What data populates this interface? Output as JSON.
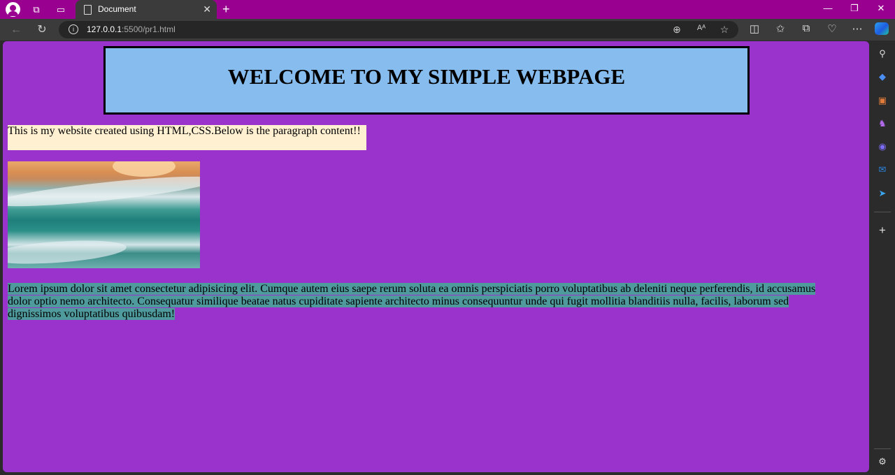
{
  "browser": {
    "tab_title": "Document",
    "tab_close_glyph": "✕",
    "new_tab_glyph": "+",
    "url_host": "127.0.0.1",
    "url_rest": ":5500/pr1.html",
    "window_controls": {
      "minimize": "—",
      "restore": "❐",
      "close": "✕"
    }
  },
  "page": {
    "heading": "WELCOME TO MY SIMPLE WEBPAGE",
    "intro_text": "This is my website created using HTML,CSS.Below is the paragraph content!!",
    "paragraph": "Lorem ipsum dolor sit amet consectetur adipisicing elit. Cumque autem eius saepe rerum soluta ea omnis perspiciatis porro voluptatibus ab deleniti neque perferendis, id accusamus dolor optio nemo architecto. Consequatur similique beatae natus cupiditate sapiente architecto minus consequuntur unde qui fugit mollitia blanditiis nulla, facilis, laborum sed dignissimos voluptatibus quibusdam!"
  },
  "colors": {
    "titlebar": "#9a008f",
    "page_background": "#9933cc",
    "header_box": "#87bdee",
    "intro_background": "#fff0d2",
    "paragraph_highlight": "#4e9a9c"
  },
  "icons": [
    "profile-icon",
    "workspaces-icon",
    "tab-actions-icon",
    "document-icon",
    "back-icon",
    "refresh-icon",
    "info-icon",
    "zoom-icon",
    "read-aloud-icon",
    "favorite-star-icon",
    "split-screen-icon",
    "favorites-icon",
    "collections-icon",
    "browser-essentials-icon",
    "more-icon",
    "copilot-icon",
    "search-icon",
    "shopping-icon",
    "tools-icon",
    "games-icon",
    "microsoft365-icon",
    "outlook-icon",
    "send-icon",
    "add-icon",
    "settings-icon"
  ]
}
